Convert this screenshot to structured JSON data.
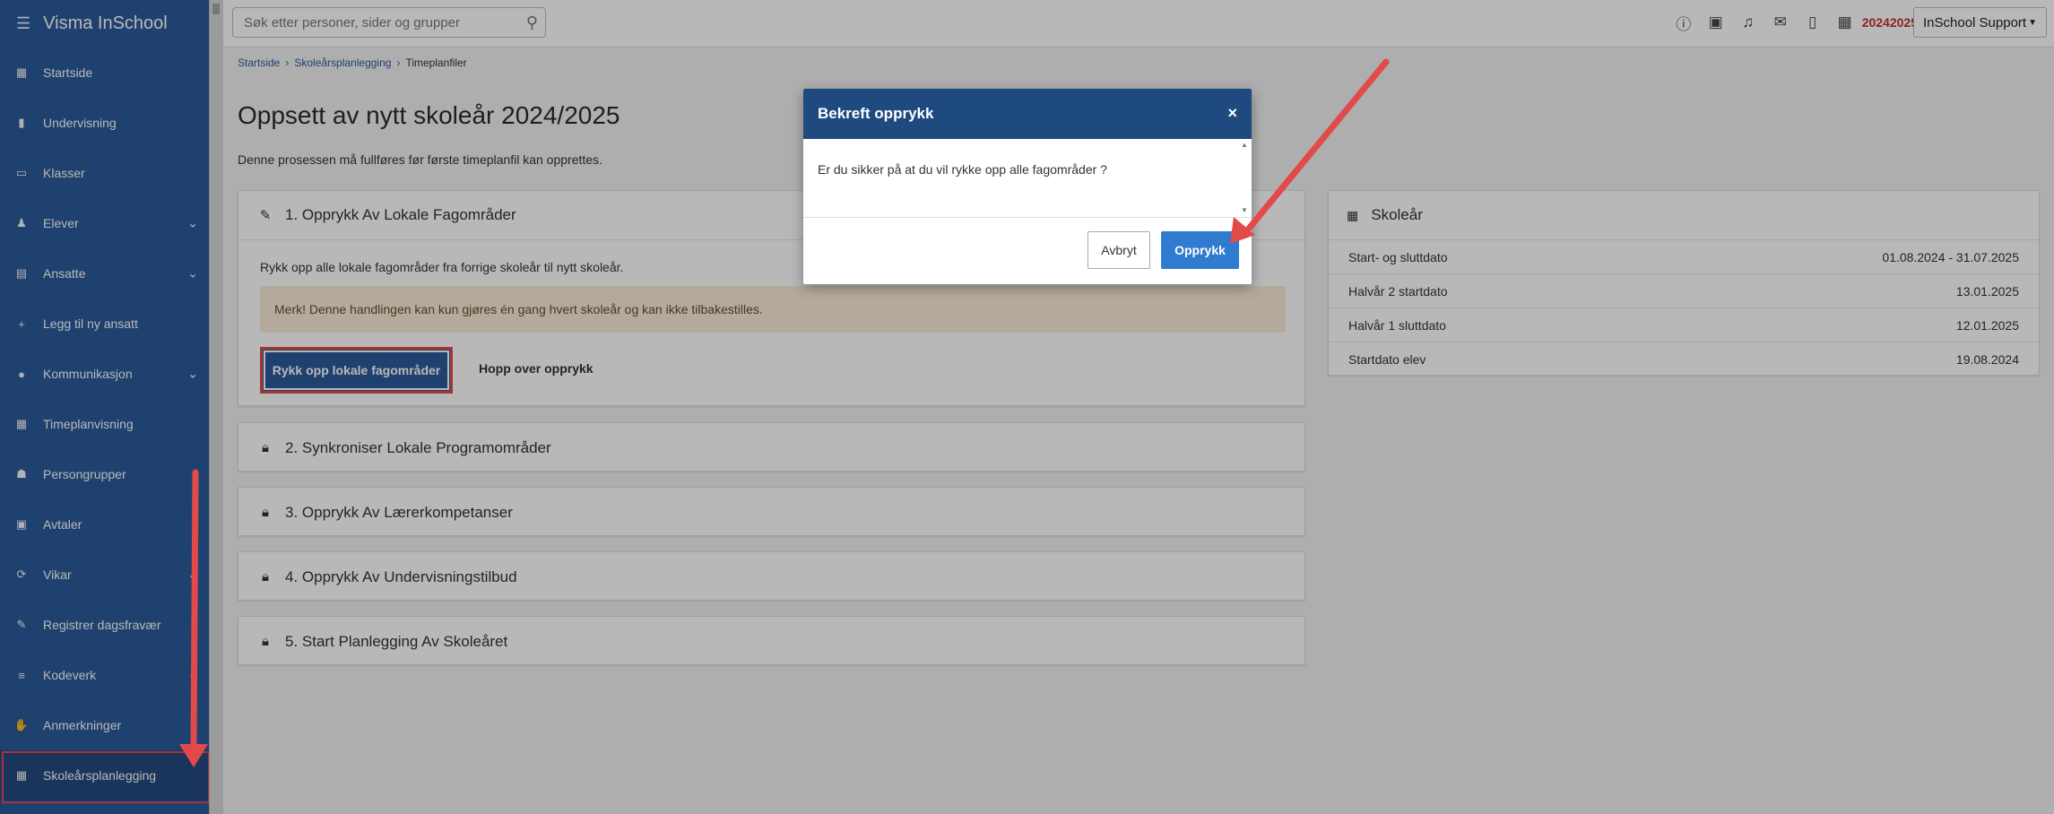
{
  "app": {
    "brand": "Visma InSchool"
  },
  "sidebar": {
    "items": [
      {
        "label": "Startside",
        "icon": "grid-icon",
        "chevron": false
      },
      {
        "label": "Undervisning",
        "icon": "book-icon",
        "chevron": false
      },
      {
        "label": "Klasser",
        "icon": "classroom-icon",
        "chevron": false
      },
      {
        "label": "Elever",
        "icon": "student-icon",
        "chevron": true
      },
      {
        "label": "Ansatte",
        "icon": "briefcase-icon",
        "chevron": true
      },
      {
        "label": "Legg til ny ansatt",
        "icon": "plus-icon",
        "chevron": false
      },
      {
        "label": "Kommunikasjon",
        "icon": "chat-icon",
        "chevron": true
      },
      {
        "label": "Timeplanvisning",
        "icon": "calendar-icon",
        "chevron": false
      },
      {
        "label": "Persongrupper",
        "icon": "group-icon",
        "chevron": false
      },
      {
        "label": "Avtaler",
        "icon": "calendar-check-icon",
        "chevron": false
      },
      {
        "label": "Vikar",
        "icon": "refresh-icon",
        "chevron": true
      },
      {
        "label": "Registrer dagsfravær",
        "icon": "pencil-icon",
        "chevron": false
      },
      {
        "label": "Kodeverk",
        "icon": "database-icon",
        "chevron": true
      },
      {
        "label": "Anmerkninger",
        "icon": "hand-icon",
        "chevron": false
      },
      {
        "label": "Skoleårsplanlegging",
        "icon": "calendar-icon",
        "chevron": false,
        "active": true
      }
    ]
  },
  "topbar": {
    "search_placeholder": "Søk etter personer, sider og grupper",
    "year": "20242025",
    "user": "InSchool Support"
  },
  "breadcrumb": {
    "items": [
      "Startside",
      "Skoleårsplanlegging"
    ],
    "current": "Timeplanfiler"
  },
  "page": {
    "title": "Oppsett av nytt skoleår 2024/2025",
    "subtitle": "Denne prosessen må fullføres før første timeplanfil kan opprettes."
  },
  "steps": {
    "s1": {
      "title": "1. Opprykk Av Lokale Fagområder",
      "desc": "Rykk opp alle lokale fagområder fra forrige skoleår til nytt skoleår.",
      "warning": "Merk! Denne handlingen kan kun gjøres én gang hvert skoleår og kan ikke tilbakestilles.",
      "primary": "Rykk opp lokale fagområder",
      "skip": "Hopp over opprykk"
    },
    "s2": "2. Synkroniser Lokale Programområder",
    "s3": "3. Opprykk Av Lærerkompetanser",
    "s4": "4. Opprykk Av Undervisningstilbud",
    "s5": "5. Start Planlegging Av Skoleåret"
  },
  "skolear": {
    "title": "Skoleår",
    "rows": [
      {
        "label": "Start- og sluttdato",
        "value": "01.08.2024 - 31.07.2025"
      },
      {
        "label": "Halvår 2 startdato",
        "value": "13.01.2025"
      },
      {
        "label": "Halvår 1 sluttdato",
        "value": "12.01.2025"
      },
      {
        "label": "Startdato elev",
        "value": "19.08.2024"
      }
    ]
  },
  "modal": {
    "title": "Bekreft opprykk",
    "close": "×",
    "body": "Er du sikker på at du vil rykke opp alle fagområder ?",
    "cancel": "Avbryt",
    "confirm": "Opprykk"
  },
  "colors": {
    "sidebar": "#2c5a9a",
    "modal_header": "#1f4a80",
    "primary": "#2f7bd0",
    "annotation": "#e24a4a"
  }
}
